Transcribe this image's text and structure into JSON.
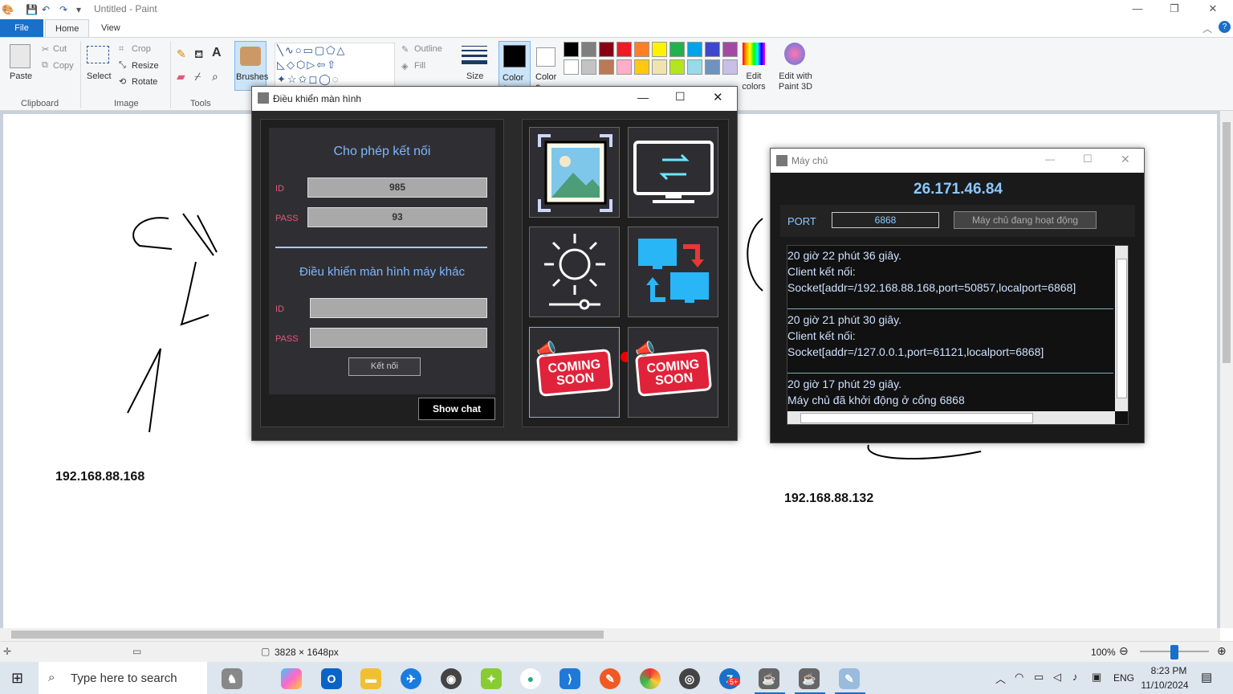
{
  "app": {
    "title": "Untitled - Paint"
  },
  "tabs": [
    {
      "label": "File"
    },
    {
      "label": "Home"
    },
    {
      "label": "View"
    }
  ],
  "ribbon": {
    "clipboard": {
      "paste": "Paste",
      "cut": "Cut",
      "copy": "Copy",
      "group": "Clipboard"
    },
    "image": {
      "select": "Select",
      "crop": "Crop",
      "resize": "Resize",
      "rotate": "Rotate",
      "group": "Image"
    },
    "tools": {
      "group": "Tools"
    },
    "brushes": "Brushes",
    "shapes": {
      "outline": "Outline",
      "fill": "Fill"
    },
    "size": "Size",
    "color1": "Color 1",
    "color2": "Color 2",
    "edit_colors": "Edit colors",
    "edit_paint3d": "Edit with Paint 3D",
    "palette_row1": [
      "#000000",
      "#7f7f7f",
      "#880015",
      "#ed1c24",
      "#ff7f27",
      "#fff200",
      "#22b14c",
      "#00a2e8",
      "#3f48cc",
      "#a349a4"
    ],
    "palette_row2": [
      "#ffffff",
      "#c3c3c3",
      "#b97a57",
      "#ffaec9",
      "#ffc90e",
      "#efe4b0",
      "#b5e61d",
      "#99d9ea",
      "#7092be",
      "#c8bfe7"
    ]
  },
  "canvas": {
    "ip_left": "192.168.88.168",
    "ip_right": "192.168.88.132"
  },
  "client_window": {
    "title": "Điều khiển màn hình",
    "allow_title": "Cho phép kết nối",
    "id_label": "ID",
    "id_value": "985",
    "pass_label": "PASS",
    "pass_value": "93",
    "control_title": "Điều khiển màn hình máy khác",
    "id2_label": "ID",
    "pass2_label": "PASS",
    "connect_button": "Kết nối",
    "show_chat": "Show chat",
    "tiles": [
      "Coming soon",
      "Coming soon"
    ],
    "coming_text": [
      "COMING",
      "SOON"
    ]
  },
  "server_window": {
    "title": "Máy chủ",
    "ip": "26.171.46.84",
    "port_label": "PORT",
    "port_value": "6868",
    "status_button": "Máy chủ đang hoạt động",
    "log": [
      "20 giờ 22 phút 36 giây.",
      "Client kết nối:",
      "Socket[addr=/192.168.88.168,port=50857,localport=6868]",
      "20 giờ 21 phút 30 giây.",
      "Client kết nối:",
      "Socket[addr=/127.0.0.1,port=61121,localport=6868]",
      "20 giờ 17 phút 29 giây.",
      "Máy chủ đã khởi động ở cổng 6868"
    ]
  },
  "status": {
    "dimensions": "3828 × 1648px",
    "zoom": "100%"
  },
  "taskbar": {
    "search_placeholder": "Type here to search",
    "lang": "ENG",
    "time": "8:23 PM",
    "date": "11/10/2024",
    "badge": "5+"
  }
}
